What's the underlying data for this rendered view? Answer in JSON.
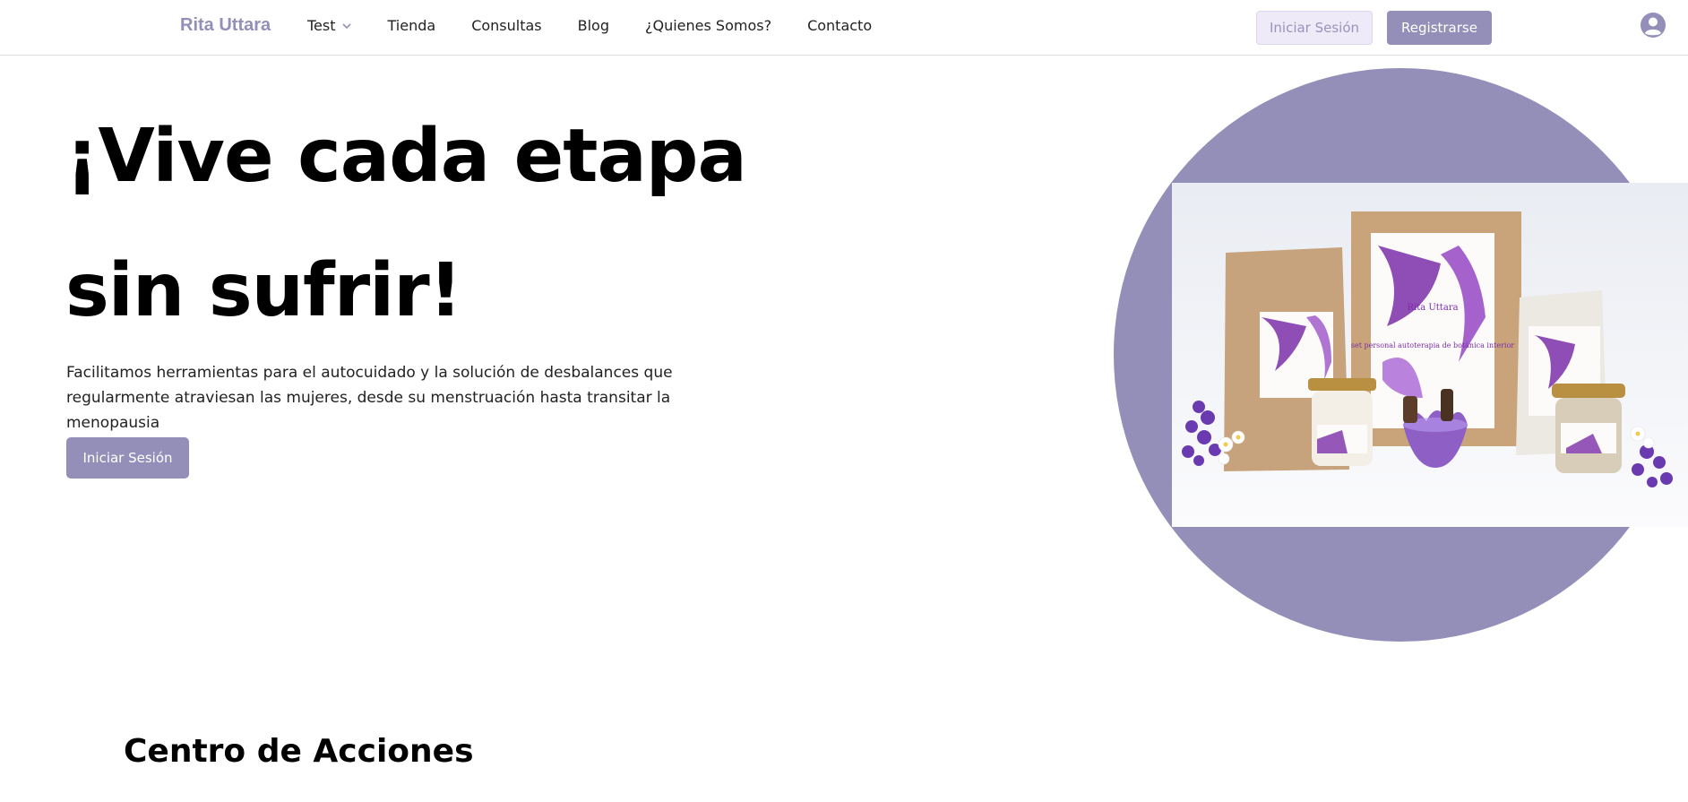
{
  "nav": {
    "brand": "Rita Uttara",
    "links": [
      {
        "label": "Test"
      },
      {
        "label": "Tienda"
      },
      {
        "label": "Consultas"
      },
      {
        "label": "Blog"
      },
      {
        "label": "¿Quienes Somos?"
      },
      {
        "label": "Contacto"
      }
    ],
    "login_label": "Iniciar Sesión",
    "register_label": "Registrarse"
  },
  "hero": {
    "title_line1": "¡Vive cada etapa",
    "title_line2": "sin sufrir!",
    "description": "Facilitamos herramientas para el autocuidado y la solución de desbalances que regularmente atraviesan las mujeres, desde su menstruación hasta transitar la menopausia",
    "cta_label": "Iniciar Sesión",
    "image": {
      "brand_label": "Rita Uttara",
      "box_text": "set personal autoterapia de botánica interior"
    }
  },
  "section": {
    "title": "Centro de Acciones"
  },
  "colors": {
    "accent": "#938fb8",
    "accent_light": "#efeaf7",
    "product_purple": "#7b2fa8"
  },
  "icons": {
    "dropdown": "chevron-down-icon",
    "account": "user-circle-icon"
  }
}
